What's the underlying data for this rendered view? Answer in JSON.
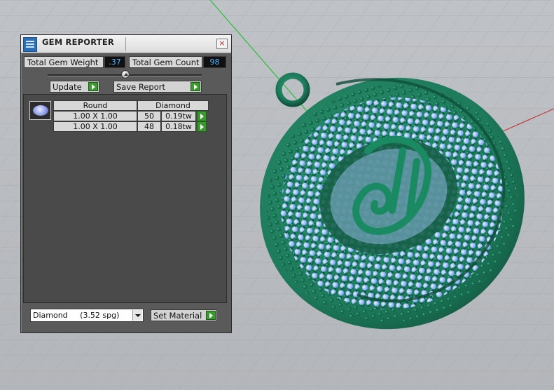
{
  "window": {
    "title": "GEM REPORTER",
    "close_glyph": "×"
  },
  "summary": {
    "total_weight_label": "Total Gem Weight",
    "total_weight_value": ".37",
    "total_count_label": "Total Gem Count",
    "total_count_value": "98"
  },
  "actions": {
    "update_label": "Update",
    "save_report_label": "Save Report"
  },
  "table": {
    "headers": [
      "Round",
      "Diamond"
    ],
    "rows": [
      {
        "size": "1.00 X 1.00",
        "count": "50",
        "weight": "0.19tw"
      },
      {
        "size": "1.00 X 1.00",
        "count": "48",
        "weight": "0.18tw"
      }
    ]
  },
  "material": {
    "selected": "Diamond     (3.52 spg)",
    "set_material_label": "Set Material"
  },
  "colors": {
    "panel_bg": "#5a5a5a",
    "value_text": "#4fb6ff",
    "accent_green": "#3b9a2e",
    "model_green": "#1a7a5c",
    "gem_blue": "#8fb6ff"
  },
  "icons": {
    "app": "gem-reporter-app-icon",
    "close": "close-icon",
    "gem": "round-gem-icon",
    "play": "play-arrow-icon",
    "dropdown": "chevron-down-icon"
  }
}
